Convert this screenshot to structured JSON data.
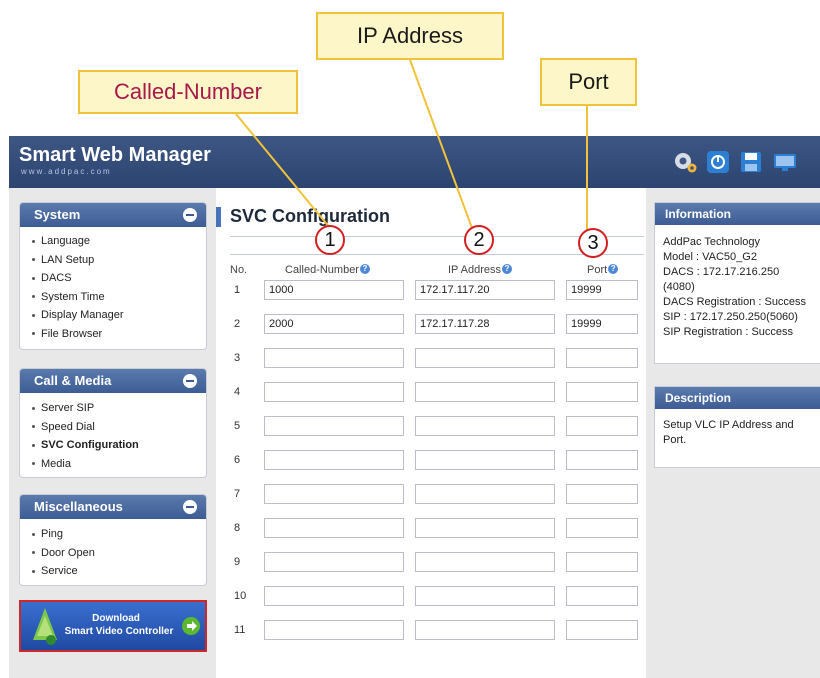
{
  "callouts": {
    "called_number": "Called-Number",
    "ip_address": "IP Address",
    "port": "Port"
  },
  "header": {
    "brand": "Smart Web Manager",
    "brand_sub": "www.addpac.com",
    "icons": [
      "gear-icon",
      "power-icon",
      "save-icon",
      "monitor-icon"
    ]
  },
  "sidebar": {
    "system": {
      "title": "System",
      "items": [
        "Language",
        "LAN Setup",
        "DACS",
        "System Time",
        "Display Manager",
        "File Browser"
      ]
    },
    "call_media": {
      "title": "Call & Media",
      "items": [
        "Server SIP",
        "Speed Dial",
        "SVC Configuration",
        "Media"
      ],
      "active": "SVC Configuration"
    },
    "misc": {
      "title": "Miscellaneous",
      "items": [
        "Ping",
        "Door Open",
        "Service"
      ]
    },
    "download": {
      "line1": "Download",
      "line2": "Smart Video Controller"
    }
  },
  "content": {
    "title": "SVC Configuration",
    "columns": {
      "no": "No.",
      "called_number": "Called-Number",
      "ip_address": "IP Address",
      "port": "Port"
    },
    "markers": [
      "1",
      "2",
      "3"
    ],
    "rows": [
      {
        "no": "1",
        "called": "1000",
        "ip": "172.17.117.20",
        "port": "19999"
      },
      {
        "no": "2",
        "called": "2000",
        "ip": "172.17.117.28",
        "port": "19999"
      },
      {
        "no": "3",
        "called": "",
        "ip": "",
        "port": ""
      },
      {
        "no": "4",
        "called": "",
        "ip": "",
        "port": ""
      },
      {
        "no": "5",
        "called": "",
        "ip": "",
        "port": ""
      },
      {
        "no": "6",
        "called": "",
        "ip": "",
        "port": ""
      },
      {
        "no": "7",
        "called": "",
        "ip": "",
        "port": ""
      },
      {
        "no": "8",
        "called": "",
        "ip": "",
        "port": ""
      },
      {
        "no": "9",
        "called": "",
        "ip": "",
        "port": ""
      },
      {
        "no": "10",
        "called": "",
        "ip": "",
        "port": ""
      },
      {
        "no": "11",
        "called": "",
        "ip": "",
        "port": ""
      }
    ]
  },
  "info": {
    "title": "Information",
    "lines": [
      "AddPac Technology",
      "Model : VAC50_G2",
      "DACS : 172.17.216.250",
      "(4080)",
      "DACS Registration : Success",
      "SIP : 172.17.250.250(5060)",
      "SIP Registration : Success"
    ]
  },
  "description": {
    "title": "Description",
    "lines": [
      "Setup VLC IP Address and",
      "Port."
    ]
  }
}
